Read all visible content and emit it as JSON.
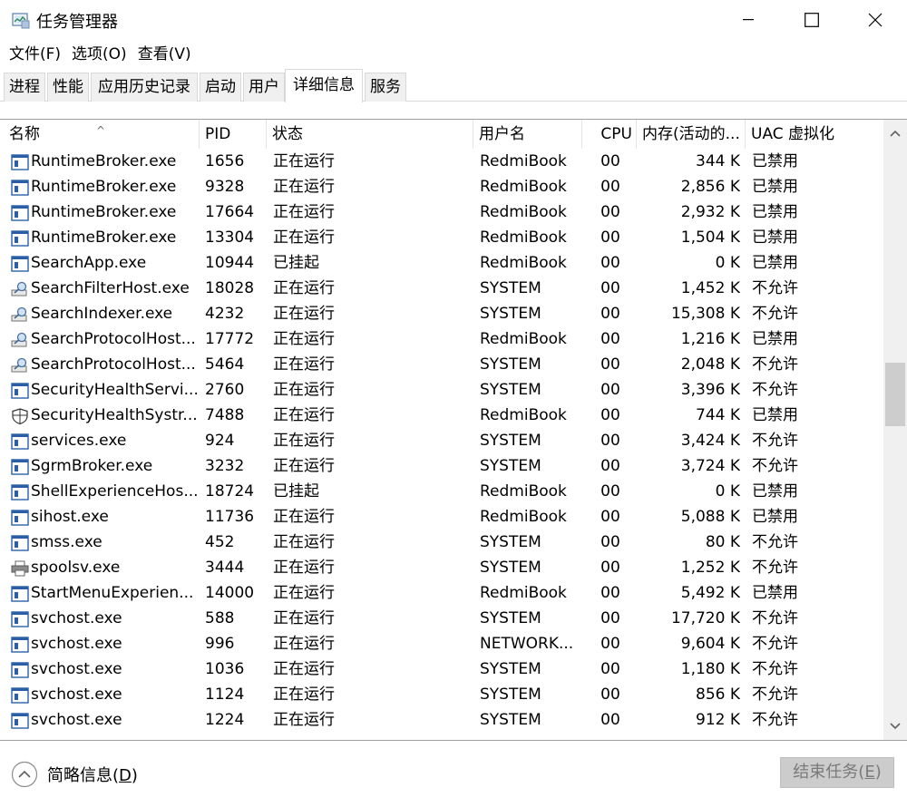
{
  "window": {
    "title": "任务管理器"
  },
  "menu": [
    "文件(F)",
    "选项(O)",
    "查看(V)"
  ],
  "tabs": [
    "进程",
    "性能",
    "应用历史记录",
    "启动",
    "用户",
    "详细信息",
    "服务"
  ],
  "active_tab": "详细信息",
  "columns": [
    "名称",
    "PID",
    "状态",
    "用户名",
    "CPU",
    "内存(活动的...",
    "UAC 虚拟化"
  ],
  "rows": [
    {
      "name": "RuntimeBroker.exe",
      "pid": "1656",
      "status": "正在运行",
      "user": "RedmiBook",
      "cpu": "00",
      "mem": "344 K",
      "uac": "已禁用",
      "icon": "app-window-icon"
    },
    {
      "name": "RuntimeBroker.exe",
      "pid": "9328",
      "status": "正在运行",
      "user": "RedmiBook",
      "cpu": "00",
      "mem": "2,856 K",
      "uac": "已禁用",
      "icon": "app-window-icon"
    },
    {
      "name": "RuntimeBroker.exe",
      "pid": "17664",
      "status": "正在运行",
      "user": "RedmiBook",
      "cpu": "00",
      "mem": "2,932 K",
      "uac": "已禁用",
      "icon": "app-window-icon"
    },
    {
      "name": "RuntimeBroker.exe",
      "pid": "13304",
      "status": "正在运行",
      "user": "RedmiBook",
      "cpu": "00",
      "mem": "1,504 K",
      "uac": "已禁用",
      "icon": "app-window-icon"
    },
    {
      "name": "SearchApp.exe",
      "pid": "10944",
      "status": "已挂起",
      "user": "RedmiBook",
      "cpu": "00",
      "mem": "0 K",
      "uac": "已禁用",
      "icon": "app-window-icon"
    },
    {
      "name": "SearchFilterHost.exe",
      "pid": "18028",
      "status": "正在运行",
      "user": "SYSTEM",
      "cpu": "00",
      "mem": "1,452 K",
      "uac": "不允许",
      "icon": "search-service-icon"
    },
    {
      "name": "SearchIndexer.exe",
      "pid": "4232",
      "status": "正在运行",
      "user": "SYSTEM",
      "cpu": "00",
      "mem": "15,308 K",
      "uac": "不允许",
      "icon": "search-service-icon"
    },
    {
      "name": "SearchProtocolHost...",
      "pid": "17772",
      "status": "正在运行",
      "user": "RedmiBook",
      "cpu": "00",
      "mem": "1,216 K",
      "uac": "已禁用",
      "icon": "search-service-icon"
    },
    {
      "name": "SearchProtocolHost...",
      "pid": "5464",
      "status": "正在运行",
      "user": "SYSTEM",
      "cpu": "00",
      "mem": "2,048 K",
      "uac": "不允许",
      "icon": "search-service-icon"
    },
    {
      "name": "SecurityHealthServi...",
      "pid": "2760",
      "status": "正在运行",
      "user": "SYSTEM",
      "cpu": "00",
      "mem": "3,396 K",
      "uac": "不允许",
      "icon": "app-window-icon"
    },
    {
      "name": "SecurityHealthSystr...",
      "pid": "7488",
      "status": "正在运行",
      "user": "RedmiBook",
      "cpu": "00",
      "mem": "744 K",
      "uac": "已禁用",
      "icon": "shield-icon"
    },
    {
      "name": "services.exe",
      "pid": "924",
      "status": "正在运行",
      "user": "SYSTEM",
      "cpu": "00",
      "mem": "3,424 K",
      "uac": "不允许",
      "icon": "app-window-icon"
    },
    {
      "name": "SgrmBroker.exe",
      "pid": "3232",
      "status": "正在运行",
      "user": "SYSTEM",
      "cpu": "00",
      "mem": "3,724 K",
      "uac": "不允许",
      "icon": "app-window-icon"
    },
    {
      "name": "ShellExperienceHos...",
      "pid": "18724",
      "status": "已挂起",
      "user": "RedmiBook",
      "cpu": "00",
      "mem": "0 K",
      "uac": "已禁用",
      "icon": "app-window-icon"
    },
    {
      "name": "sihost.exe",
      "pid": "11736",
      "status": "正在运行",
      "user": "RedmiBook",
      "cpu": "00",
      "mem": "5,088 K",
      "uac": "已禁用",
      "icon": "app-window-icon"
    },
    {
      "name": "smss.exe",
      "pid": "452",
      "status": "正在运行",
      "user": "SYSTEM",
      "cpu": "00",
      "mem": "80 K",
      "uac": "不允许",
      "icon": "app-window-icon"
    },
    {
      "name": "spoolsv.exe",
      "pid": "3444",
      "status": "正在运行",
      "user": "SYSTEM",
      "cpu": "00",
      "mem": "1,252 K",
      "uac": "不允许",
      "icon": "printer-icon"
    },
    {
      "name": "StartMenuExperien...",
      "pid": "14000",
      "status": "正在运行",
      "user": "RedmiBook",
      "cpu": "00",
      "mem": "5,492 K",
      "uac": "已禁用",
      "icon": "app-window-icon"
    },
    {
      "name": "svchost.exe",
      "pid": "588",
      "status": "正在运行",
      "user": "SYSTEM",
      "cpu": "00",
      "mem": "17,720 K",
      "uac": "不允许",
      "icon": "app-window-icon"
    },
    {
      "name": "svchost.exe",
      "pid": "996",
      "status": "正在运行",
      "user": "NETWORK...",
      "cpu": "00",
      "mem": "9,604 K",
      "uac": "不允许",
      "icon": "app-window-icon"
    },
    {
      "name": "svchost.exe",
      "pid": "1036",
      "status": "正在运行",
      "user": "SYSTEM",
      "cpu": "00",
      "mem": "1,180 K",
      "uac": "不允许",
      "icon": "app-window-icon"
    },
    {
      "name": "svchost.exe",
      "pid": "1124",
      "status": "正在运行",
      "user": "SYSTEM",
      "cpu": "00",
      "mem": "856 K",
      "uac": "不允许",
      "icon": "app-window-icon"
    },
    {
      "name": "svchost.exe",
      "pid": "1224",
      "status": "正在运行",
      "user": "SYSTEM",
      "cpu": "00",
      "mem": "912 K",
      "uac": "不允许",
      "icon": "app-window-icon"
    }
  ],
  "footer": {
    "fewer_details": "简略信息",
    "fewer_details_key": "D",
    "end_task": "结束任务",
    "end_task_key": "E"
  }
}
